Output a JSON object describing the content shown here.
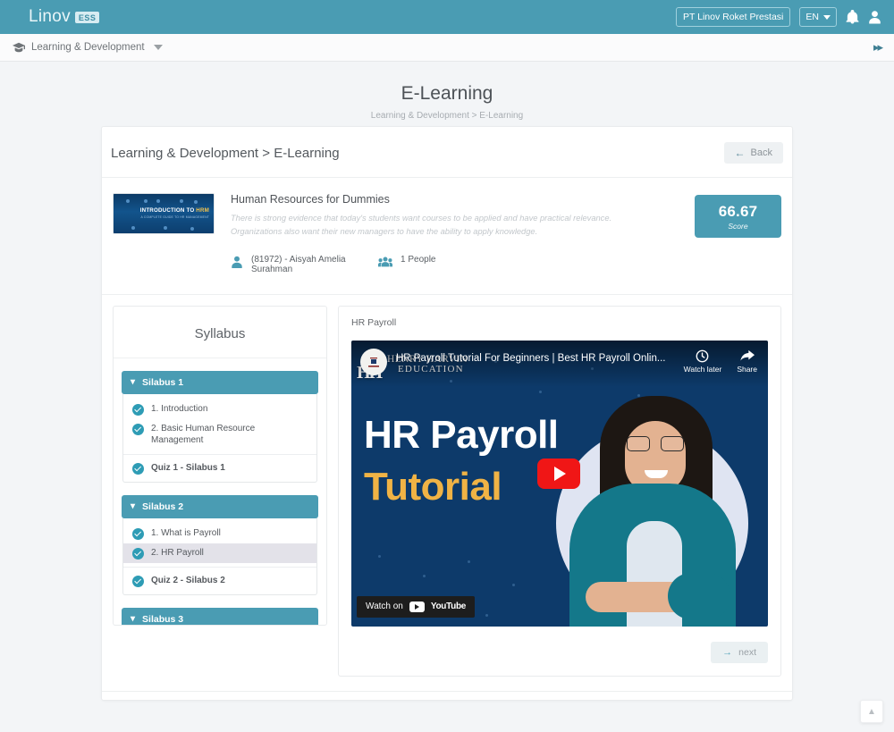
{
  "topbar": {
    "brand_name": "Linov",
    "brand_badge": "ESS",
    "company": "PT Linov Roket Prestasi",
    "language": "EN",
    "notification_icon": "bell-icon",
    "account_icon": "user-icon"
  },
  "navbar": {
    "menu_label": "Learning & Development",
    "menu_icon": "graduation-cap-icon",
    "collapse_icon": "double-chevron-right-icon"
  },
  "page": {
    "title": "E-Learning",
    "breadcrumb": "Learning & Development > E-Learning"
  },
  "card": {
    "heading": "Learning & Development > E-Learning",
    "back_label": "Back",
    "back_icon": "arrow-left-icon"
  },
  "course": {
    "thumbnail_text": "INTRODUCTION TO ",
    "thumbnail_text_accent": "HRM",
    "thumbnail_subtext": "A COMPLETE GUIDE TO HR MANAGEMENT",
    "title": "Human Resources for Dummies",
    "description": "There is strong evidence that today's students want courses to be applied and have practical relevance. Organizations also want their new managers to have the ability to apply knowledge.",
    "instructor": "(81972) - Aisyah Amelia Surahman",
    "instructor_icon": "user-icon",
    "participants": "1 People",
    "participants_icon": "group-icon",
    "score_value": "66.67",
    "score_label": "Score"
  },
  "syllabus": {
    "title": "Syllabus",
    "chevron_icon": "chevron-down-icon",
    "sections": [
      {
        "label": "Silabus 1",
        "lessons": [
          {
            "label": "1. Introduction",
            "completed": true,
            "active": false,
            "quiz": false
          },
          {
            "label": "2. Basic Human Resource Management",
            "completed": true,
            "active": false,
            "quiz": false
          },
          {
            "label": "Quiz 1 - Silabus 1",
            "completed": true,
            "active": false,
            "quiz": true
          }
        ]
      },
      {
        "label": "Silabus 2",
        "lessons": [
          {
            "label": "1. What is Payroll",
            "completed": true,
            "active": false,
            "quiz": false
          },
          {
            "label": "2. HR Payroll",
            "completed": true,
            "active": true,
            "quiz": false
          },
          {
            "label": "Quiz 2 - Silabus 2",
            "completed": true,
            "active": false,
            "quiz": true
          }
        ]
      },
      {
        "label": "Silabus 3",
        "lessons": []
      }
    ]
  },
  "video": {
    "heading": "HR Payroll",
    "yt_title": "HR Payroll Tutorial For Beginners | Best HR Payroll Onlin...",
    "watch_later_label": "Watch later",
    "watch_later_icon": "clock-icon",
    "share_label": "Share",
    "share_icon": "share-arrow-icon",
    "channel_name": "HENRY HARVIN",
    "channel_sub": "EDUCATION",
    "channel_mark": "HH",
    "big_title_line1": "HR Payroll",
    "big_title_line2": "Tutorial",
    "play_icon": "play-button-icon",
    "watch_on_label": "Watch on",
    "youtube_label": "YouTube",
    "next_label": "next",
    "next_icon": "arrow-right-icon"
  },
  "footer": {
    "to_top_icon": "chevron-up-icon"
  },
  "colors": {
    "brand_teal": "#4a9cb3",
    "check_teal": "#2e9cb5",
    "page_bg": "#f3f5f7",
    "youtube_red": "#f01616",
    "accent_yellow": "#f0b345"
  }
}
